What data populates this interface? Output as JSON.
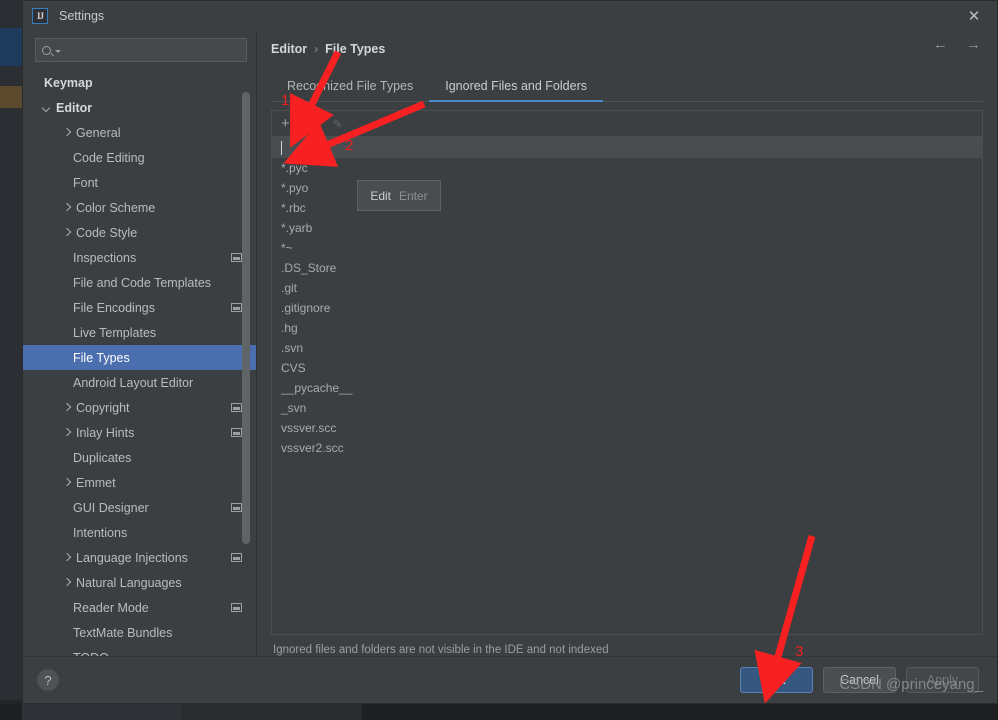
{
  "window": {
    "title": "Settings",
    "app_icon": "intellij-idea-icon",
    "close_label": "✕"
  },
  "search": {
    "value": "",
    "placeholder": "",
    "icon": "search-icon"
  },
  "sidebar": {
    "items": [
      {
        "label": "Keymap",
        "indent": 0,
        "arrow": "none",
        "bold": true,
        "selected": false,
        "badge": false
      },
      {
        "label": "Editor",
        "indent": 0,
        "arrow": "expanded",
        "bold": true,
        "selected": false,
        "badge": false
      },
      {
        "label": "General",
        "indent": 1,
        "arrow": "collapsed",
        "bold": false,
        "selected": false,
        "badge": false
      },
      {
        "label": "Code Editing",
        "indent": 1,
        "arrow": "none",
        "bold": false,
        "selected": false,
        "badge": false
      },
      {
        "label": "Font",
        "indent": 1,
        "arrow": "none",
        "bold": false,
        "selected": false,
        "badge": false
      },
      {
        "label": "Color Scheme",
        "indent": 1,
        "arrow": "collapsed",
        "bold": false,
        "selected": false,
        "badge": false
      },
      {
        "label": "Code Style",
        "indent": 1,
        "arrow": "collapsed",
        "bold": false,
        "selected": false,
        "badge": false
      },
      {
        "label": "Inspections",
        "indent": 1,
        "arrow": "none",
        "bold": false,
        "selected": false,
        "badge": true
      },
      {
        "label": "File and Code Templates",
        "indent": 1,
        "arrow": "none",
        "bold": false,
        "selected": false,
        "badge": false
      },
      {
        "label": "File Encodings",
        "indent": 1,
        "arrow": "none",
        "bold": false,
        "selected": false,
        "badge": true
      },
      {
        "label": "Live Templates",
        "indent": 1,
        "arrow": "none",
        "bold": false,
        "selected": false,
        "badge": false
      },
      {
        "label": "File Types",
        "indent": 1,
        "arrow": "none",
        "bold": false,
        "selected": true,
        "badge": false
      },
      {
        "label": "Android Layout Editor",
        "indent": 1,
        "arrow": "none",
        "bold": false,
        "selected": false,
        "badge": false
      },
      {
        "label": "Copyright",
        "indent": 1,
        "arrow": "collapsed",
        "bold": false,
        "selected": false,
        "badge": true
      },
      {
        "label": "Inlay Hints",
        "indent": 1,
        "arrow": "collapsed",
        "bold": false,
        "selected": false,
        "badge": true
      },
      {
        "label": "Duplicates",
        "indent": 1,
        "arrow": "none",
        "bold": false,
        "selected": false,
        "badge": false
      },
      {
        "label": "Emmet",
        "indent": 1,
        "arrow": "collapsed",
        "bold": false,
        "selected": false,
        "badge": false
      },
      {
        "label": "GUI Designer",
        "indent": 1,
        "arrow": "none",
        "bold": false,
        "selected": false,
        "badge": true
      },
      {
        "label": "Intentions",
        "indent": 1,
        "arrow": "none",
        "bold": false,
        "selected": false,
        "badge": false
      },
      {
        "label": "Language Injections",
        "indent": 1,
        "arrow": "collapsed",
        "bold": false,
        "selected": false,
        "badge": true
      },
      {
        "label": "Natural Languages",
        "indent": 1,
        "arrow": "collapsed",
        "bold": false,
        "selected": false,
        "badge": false
      },
      {
        "label": "Reader Mode",
        "indent": 1,
        "arrow": "none",
        "bold": false,
        "selected": false,
        "badge": true
      },
      {
        "label": "TextMate Bundles",
        "indent": 1,
        "arrow": "none",
        "bold": false,
        "selected": false,
        "badge": false
      },
      {
        "label": "TODO",
        "indent": 1,
        "arrow": "none",
        "bold": false,
        "selected": false,
        "badge": false
      }
    ]
  },
  "breadcrumb": {
    "parent": "Editor",
    "separator": "›",
    "current": "File Types"
  },
  "nav": {
    "back": "←",
    "forward": "→"
  },
  "tabs": [
    {
      "label": "Recognized File Types",
      "active": false
    },
    {
      "label": "Ignored Files and Folders",
      "active": true
    }
  ],
  "toolbar": {
    "add_label": "+",
    "remove_label": "−",
    "edit_label": "✎"
  },
  "edit_row": {
    "value": ""
  },
  "tooltip": {
    "label": "Edit",
    "shortcut": "Enter"
  },
  "ignored_list": [
    "*.pyc",
    "*.pyo",
    "*.rbc",
    "*.yarb",
    "*~",
    ".DS_Store",
    ".git",
    ".gitignore",
    ".hg",
    ".svn",
    "CVS",
    "__pycache__",
    "_svn",
    "vssver.scc",
    "vssver2.scc"
  ],
  "hint": "Ignored files and folders are not visible in the IDE and not indexed",
  "footer": {
    "help_label": "?",
    "ok_label": "OK",
    "cancel_label": "Cancel",
    "apply_label": "Apply"
  },
  "annotations": [
    {
      "number": "1",
      "target": "add-button"
    },
    {
      "number": "2",
      "target": "new-entry-field"
    },
    {
      "number": "3",
      "target": "ok-button"
    }
  ],
  "watermark": "CSDN @princeyang_",
  "colors": {
    "accent": "#4b6eaf",
    "tab_underline": "#4a88c7",
    "ok_button": "#365880",
    "annotation": "#f01f1f",
    "dialog_bg": "#3c3f41"
  }
}
